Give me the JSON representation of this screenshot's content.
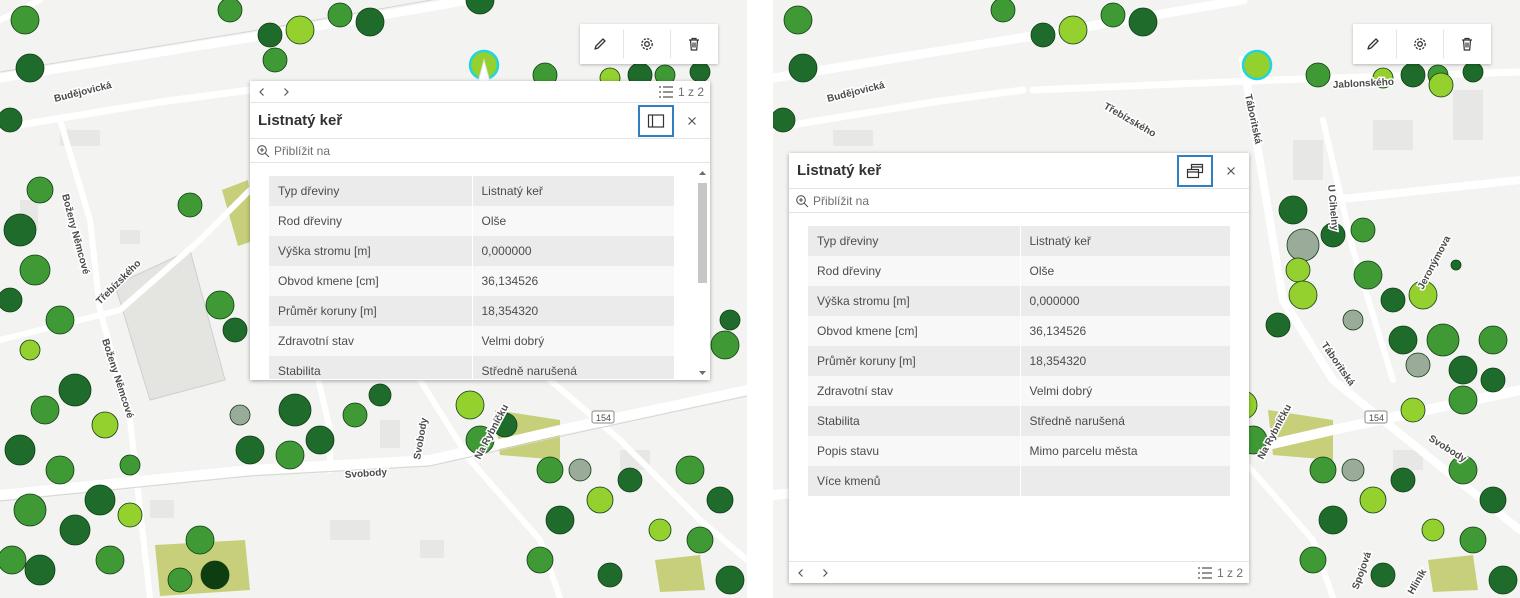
{
  "colors": {
    "accent": "#2f7fc1",
    "tree_dark": "#1e6b2c",
    "tree_mid": "#3f9a35",
    "tree_light": "#94d02e",
    "tree_gray": "#9aab9a",
    "selection": "#22d4dd",
    "park": "#c7cf7b"
  },
  "map": {
    "streets": [
      "Budějovická",
      "Boženy Němcové",
      "Třebízského",
      "Svobody",
      "Svobody",
      "Na Rybníčku",
      "Jablonského",
      "Táboritská",
      "U Cihelny",
      "Jeronýmova",
      "Spojová",
      "Hliník"
    ],
    "route_shield": "154"
  },
  "toolbar": {
    "edit_icon": "pencil-icon",
    "settings_icon": "gear-icon",
    "delete_icon": "trash-icon"
  },
  "popup": {
    "title": "Listnatý keř",
    "zoom_label": "Přiblížit na",
    "feature_count": "1 z 2",
    "attributes": [
      {
        "key": "Typ dřeviny",
        "value": "Listnatý keř"
      },
      {
        "key": "Rod dřeviny",
        "value": "Olše"
      },
      {
        "key": "Výška stromu [m]",
        "value": "0,000000"
      },
      {
        "key": "Obvod kmene [cm]",
        "value": "36,134526"
      },
      {
        "key": "Průměr koruny [m]",
        "value": "18,354320"
      },
      {
        "key": "Zdravotní stav",
        "value": "Velmi dobrý"
      },
      {
        "key": "Stabilita",
        "value": "Středně narušená"
      },
      {
        "key": "Popis stavu",
        "value": "Mimo parcelu města"
      },
      {
        "key": "Více kmenů",
        "value": ""
      }
    ]
  }
}
